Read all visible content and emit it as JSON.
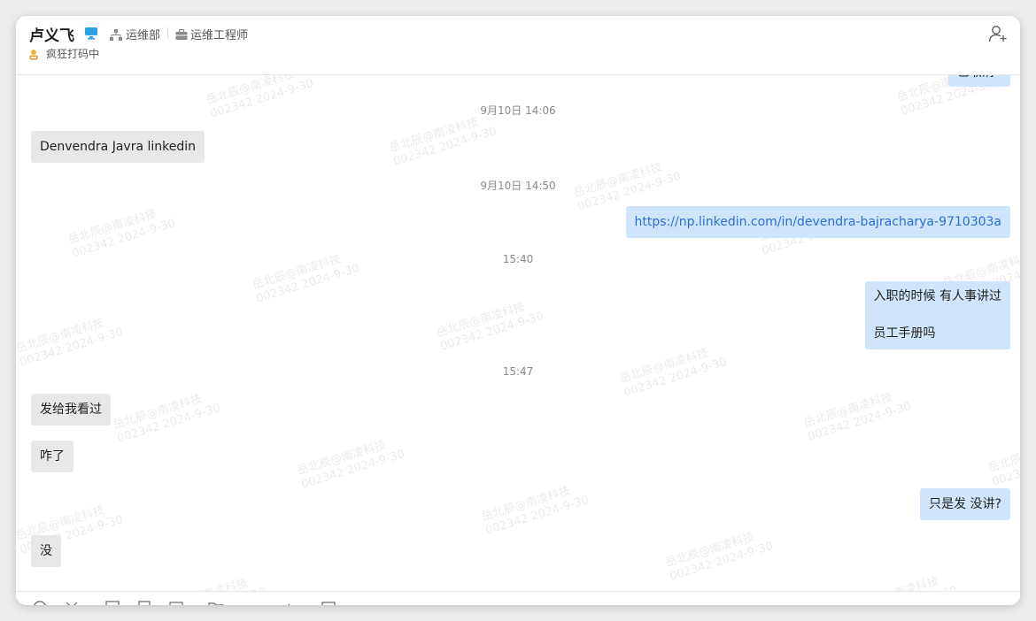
{
  "header": {
    "contact_name": "卢义飞",
    "department": "运维部",
    "job_title": "运维工程师",
    "status": "疯狂打码中",
    "device_icon": "desktop-icon",
    "add_member_icon": "add-user-icon"
  },
  "colors": {
    "outgoing_bubble": "#cfe5fb",
    "incoming_bubble": "#e8e8e8",
    "link": "#2b6fd6",
    "device_icon": "#2ba0e6"
  },
  "chat": {
    "partial_top_message": "已取消",
    "timestamps": [
      "9月10日 14:06",
      "9月10日 14:50",
      "15:40",
      "15:47"
    ],
    "messages": [
      {
        "direction": "in",
        "text": "Denvendra Javra linkedin"
      },
      {
        "direction": "out",
        "text": "https://np.linkedin.com/in/devendra-bajracharya-9710303a",
        "is_link": true
      },
      {
        "direction": "out",
        "lines": [
          "入职的时候 有人事讲过",
          "员工手册吗"
        ]
      },
      {
        "direction": "in",
        "text": "发给我看过"
      },
      {
        "direction": "in",
        "text": "咋了"
      },
      {
        "direction": "out",
        "text": "只是发 没讲?"
      },
      {
        "direction": "in",
        "text": "没"
      }
    ],
    "watermark": {
      "line1": "岳北辰@南凌科技",
      "line2": "002342 2024-9-30"
    }
  },
  "toolbar": {
    "icons": [
      "emoji-icon",
      "scissors-icon",
      "image-icon",
      "file-icon",
      "calendar-icon",
      "folder-icon",
      "edit-icon",
      "screen-icon"
    ]
  }
}
